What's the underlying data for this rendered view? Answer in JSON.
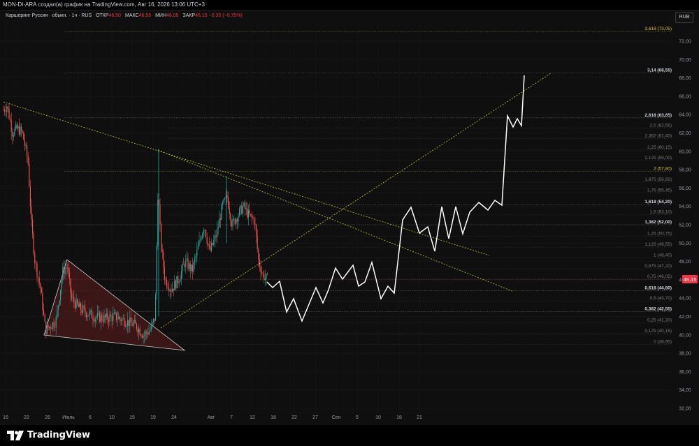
{
  "header": {
    "publisher_text": "MON-DI-ARA создал(а) график на TradingView.com, Авг 16, 2026 13:06 UTC+3"
  },
  "legend": {
    "symbol": "Каршеринг Руссия · обыкн. · 1ч · RUS",
    "open_label": "ОТКР",
    "open_value": "46,50",
    "high_label": "МАКС",
    "high_value": "46,55",
    "low_label": "МИН",
    "low_value": "46,05",
    "close_label": "ЗАКР",
    "close_value": "46,15",
    "change_value": "−0,35 (−0,75%)"
  },
  "currency_button": "RUB",
  "brand": {
    "name": "TradingView"
  },
  "price_axis": {
    "ticks": [
      "72,00",
      "70,00",
      "68,00",
      "66,00",
      "64,00",
      "62,00",
      "60,00",
      "58,00",
      "56,00",
      "54,00",
      "52,00",
      "50,00",
      "48,00",
      "46,00",
      "44,00",
      "42,00",
      "40,00",
      "38,00",
      "36,00",
      "34,00",
      "32,00"
    ],
    "last_price": "46,15",
    "last_price_color": "#f23645"
  },
  "time_axis": {
    "labels": [
      "16",
      "22",
      "26",
      "Июль",
      "6",
      "10",
      "15",
      "19",
      "24",
      "Авг",
      "7",
      "12",
      "18",
      "22",
      "27",
      "Сен",
      "5",
      "10",
      "16",
      "21"
    ]
  },
  "fib_levels": [
    {
      "label": "3,618 (73,05)",
      "price": 73.05,
      "color": "#e0c03a",
      "bold": false
    },
    {
      "label": "3,14 (68,55)",
      "price": 68.55,
      "color": "#d1d4dc",
      "bold": true
    },
    {
      "label": "2,618 (63,65)",
      "price": 63.65,
      "color": "#d1d4dc",
      "bold": true
    },
    {
      "label": "2,5 (62,55)",
      "price": 62.55,
      "color": "#7a7a7a",
      "bold": false
    },
    {
      "label": "2,382 (61,40)",
      "price": 61.4,
      "color": "#7a7a7a",
      "bold": false
    },
    {
      "label": "2,25 (60,15)",
      "price": 60.15,
      "color": "#7a7a7a",
      "bold": false
    },
    {
      "label": "2,125 (59,00)",
      "price": 59.0,
      "color": "#7a7a7a",
      "bold": false
    },
    {
      "label": "2 (57,80)",
      "price": 57.8,
      "color": "#e0c03a",
      "bold": false
    },
    {
      "label": "1,875 (56,65)",
      "price": 56.65,
      "color": "#7a7a7a",
      "bold": false
    },
    {
      "label": "1,75 (55,45)",
      "price": 55.45,
      "color": "#7a7a7a",
      "bold": false
    },
    {
      "label": "1,618 (54,20)",
      "price": 54.2,
      "color": "#d1d4dc",
      "bold": true
    },
    {
      "label": "1,5 (53,10)",
      "price": 53.1,
      "color": "#7a7a7a",
      "bold": false
    },
    {
      "label": "1,382 (52,00)",
      "price": 52.0,
      "color": "#d1d4dc",
      "bold": true
    },
    {
      "label": "1,25 (50,75)",
      "price": 50.75,
      "color": "#7a7a7a",
      "bold": false
    },
    {
      "label": "1,125 (49,55)",
      "price": 49.55,
      "color": "#7a7a7a",
      "bold": false
    },
    {
      "label": "1 (48,40)",
      "price": 48.4,
      "color": "#7a7a7a",
      "bold": false
    },
    {
      "label": "0,875 (47,20)",
      "price": 47.2,
      "color": "#7a7a7a",
      "bold": false
    },
    {
      "label": "0,75 (46,05)",
      "price": 46.05,
      "color": "#7a7a7a",
      "bold": false
    },
    {
      "label": "0,618 (44,80)",
      "price": 44.8,
      "color": "#d1d4dc",
      "bold": true
    },
    {
      "label": "0,5 (43,70)",
      "price": 43.7,
      "color": "#7a7a7a",
      "bold": false
    },
    {
      "label": "0,382 (42,55)",
      "price": 42.55,
      "color": "#d1d4dc",
      "bold": true
    },
    {
      "label": "0,25 (41,30)",
      "price": 41.3,
      "color": "#7a7a7a",
      "bold": false
    },
    {
      "label": "0,125 (40,15)",
      "price": 40.15,
      "color": "#7a7a7a",
      "bold": false
    },
    {
      "label": "0 (38,95)",
      "price": 38.95,
      "color": "#7a7a7a",
      "bold": false
    }
  ],
  "colors": {
    "up": "#26a69a",
    "down": "#ef5350",
    "projection": "#ffffff",
    "trendline": "#c8c832",
    "triangle_fill": "#4a1a1a"
  }
}
